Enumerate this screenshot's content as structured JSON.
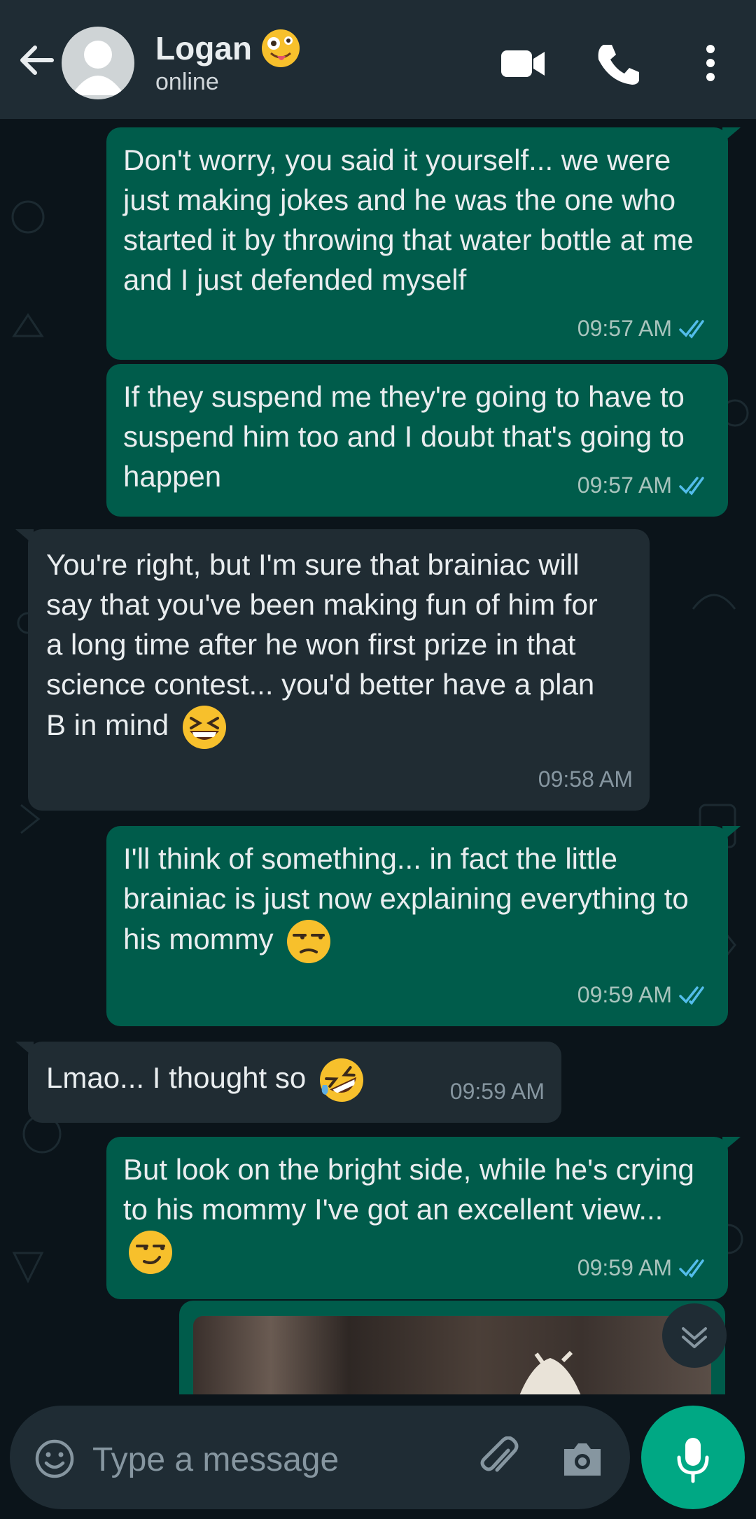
{
  "header": {
    "contact_name": "Logan",
    "status": "online",
    "icons": [
      "back-arrow-icon",
      "avatar",
      "video-call-icon",
      "voice-call-icon",
      "more-options-icon"
    ]
  },
  "messages": [
    {
      "dir": "out",
      "text": "Don't worry, you said it yourself... we were just making jokes and he was the one who started it by throwing that water bottle at me and I just defended myself",
      "time": "09:57 AM",
      "read": true
    },
    {
      "dir": "out",
      "text": "If they suspend me they're going to have to suspend him too and I doubt that's going to happen",
      "time": "09:57 AM",
      "read": true
    },
    {
      "dir": "in",
      "text": "You're right, but I'm sure that brainiac will say that you've been making fun of him for a long time after he won first prize in that science contest... you'd better have a plan B in mind",
      "emoji": "grinning-squinting-face",
      "time": "09:58 AM"
    },
    {
      "dir": "out",
      "text": "I'll think of something... in fact the little brainiac is just now explaining everything to his mommy",
      "emoji": "unamused-face",
      "time": "09:59 AM",
      "read": true
    },
    {
      "dir": "in",
      "text": "Lmao... I thought so",
      "emoji": "rolling-on-floor-laughing",
      "time": "09:59 AM"
    },
    {
      "dir": "out",
      "text": "But look on the bright side, while he's crying to his mommy I've got an excellent view...",
      "emoji": "smirking-face",
      "time": "09:59 AM",
      "read": true
    }
  ],
  "composer": {
    "placeholder": "Type a message"
  },
  "colors": {
    "background": "#0b141a",
    "header": "#1f2c34",
    "outgoing": "#005c4b",
    "incoming": "#202c33",
    "accent": "#00a884",
    "read_ticks": "#53bdeb"
  }
}
